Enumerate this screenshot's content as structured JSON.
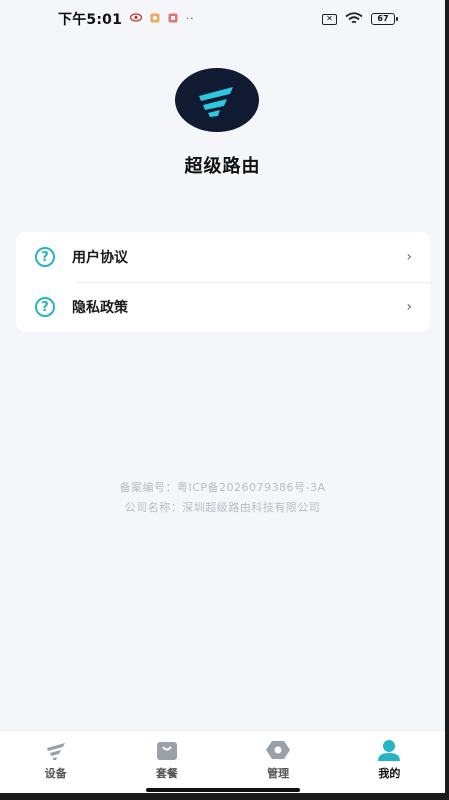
{
  "status_bar": {
    "time": "下午5:01",
    "dots": "··",
    "battery": "67"
  },
  "header": {
    "app_name": "超级路由"
  },
  "menu": {
    "items": [
      {
        "label": "用户协议",
        "icon": "help-circle-icon"
      },
      {
        "label": "隐私政策",
        "icon": "help-circle-icon"
      }
    ],
    "help_glyph": "?",
    "chevron": "›"
  },
  "footer": {
    "icp": "备案编号：粤ICP备2026079386号-3A",
    "company": "公司名称：深圳超级路由科技有限公司"
  },
  "tab_bar": {
    "tabs": [
      {
        "label": "设备",
        "icon": "wifi-device-icon"
      },
      {
        "label": "套餐",
        "icon": "shopping-bag-icon"
      },
      {
        "label": "管理",
        "icon": "settings-hex-icon"
      },
      {
        "label": "我的",
        "icon": "user-icon",
        "active": true
      }
    ]
  },
  "colors": {
    "accent": "#25b4c2",
    "logo_bg": "#101b31",
    "background": "#f4f6fa"
  }
}
